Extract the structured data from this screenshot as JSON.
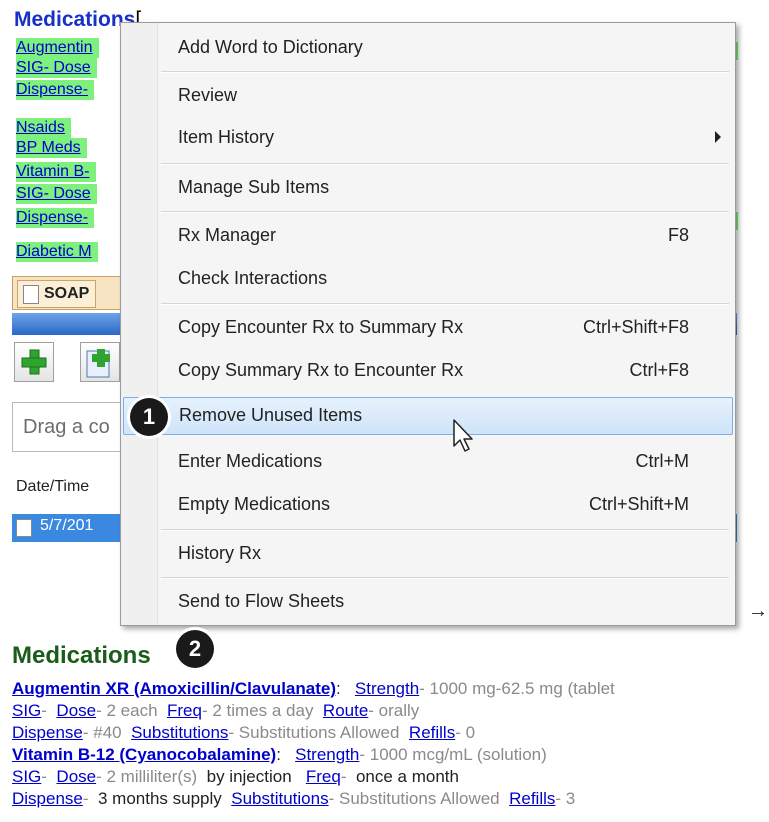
{
  "background": {
    "title": "Medications",
    "lines": [
      "Augmentin",
      "SIG- Dose",
      "Dispense-",
      "Nsaids",
      "BP Meds",
      "Vitamin B-",
      "SIG- Dose",
      "Dispense-",
      "Diabetic M"
    ],
    "soap_tab_label": "SOAP",
    "drag_placeholder": "Drag a co",
    "grid_header": "Date/Time",
    "grid_row_value": "5/7/201",
    "arrow_glyph": "→"
  },
  "context_menu": {
    "items": [
      {
        "label": "Add Word to Dictionary",
        "shortcut": ""
      },
      {
        "label": "Review",
        "shortcut": ""
      },
      {
        "label": "Item History",
        "shortcut": ""
      },
      {
        "label": "Manage Sub Items",
        "shortcut": ""
      },
      {
        "label": "Rx Manager",
        "shortcut": "F8"
      },
      {
        "label": "Check Interactions",
        "shortcut": ""
      },
      {
        "label": "Copy Encounter Rx to Summary Rx",
        "shortcut": "Ctrl+Shift+F8"
      },
      {
        "label": "Copy Summary Rx to Encounter Rx",
        "shortcut": "Ctrl+F8"
      },
      {
        "label": "Remove Unused Items",
        "shortcut": ""
      },
      {
        "label": "Enter Medications",
        "shortcut": "Ctrl+M"
      },
      {
        "label": "Empty Medications",
        "shortcut": "Ctrl+Shift+M"
      },
      {
        "label": "History Rx",
        "shortcut": ""
      },
      {
        "label": "Send to Flow Sheets",
        "shortcut": ""
      }
    ],
    "highlighted_item": "Remove Unused Items"
  },
  "steps": [
    "1",
    "2"
  ],
  "result": {
    "title": "Medications",
    "med1": {
      "name": "Augmentin XR (Amoxicillin/Clavulanate)",
      "strength_label": "Strength",
      "strength_value": "- 1000 mg-62.5 mg (tablet",
      "sig": "SIG",
      "dose_label": "Dose",
      "dose_value": "- 2 each",
      "freq_label": "Freq",
      "freq_value": "- 2 times a day",
      "route_label": "Route",
      "route_value": "- orally",
      "dispense_label": "Dispense",
      "dispense_value": "- #40",
      "subs_label": "Substitutions",
      "subs_value": "- Substitutions Allowed",
      "refills_label": "Refills",
      "refills_value": "- 0"
    },
    "med2": {
      "name": "Vitamin B-12 (Cyanocobalamine)",
      "strength_label": "Strength",
      "strength_value": "- 1000 mcg/mL (solution)",
      "sig": "SIG",
      "dose_label": "Dose",
      "dose_value": "- 2 milliliter(s)",
      "dose_extra": "by injection",
      "freq_label": "Freq",
      "freq_value": "-",
      "freq_extra": "once a month",
      "dispense_label": "Dispense",
      "dispense_value": "-",
      "dispense_extra": "3 months supply",
      "subs_label": "Substitutions",
      "subs_value": "- Substitutions Allowed",
      "refills_label": "Refills",
      "refills_value": "- 3"
    }
  },
  "colors": {
    "highlight_green": "#7df07d",
    "link_blue": "#0000cc",
    "menu_hover": "#cfe4fa",
    "selected_row": "#3a88e0"
  }
}
